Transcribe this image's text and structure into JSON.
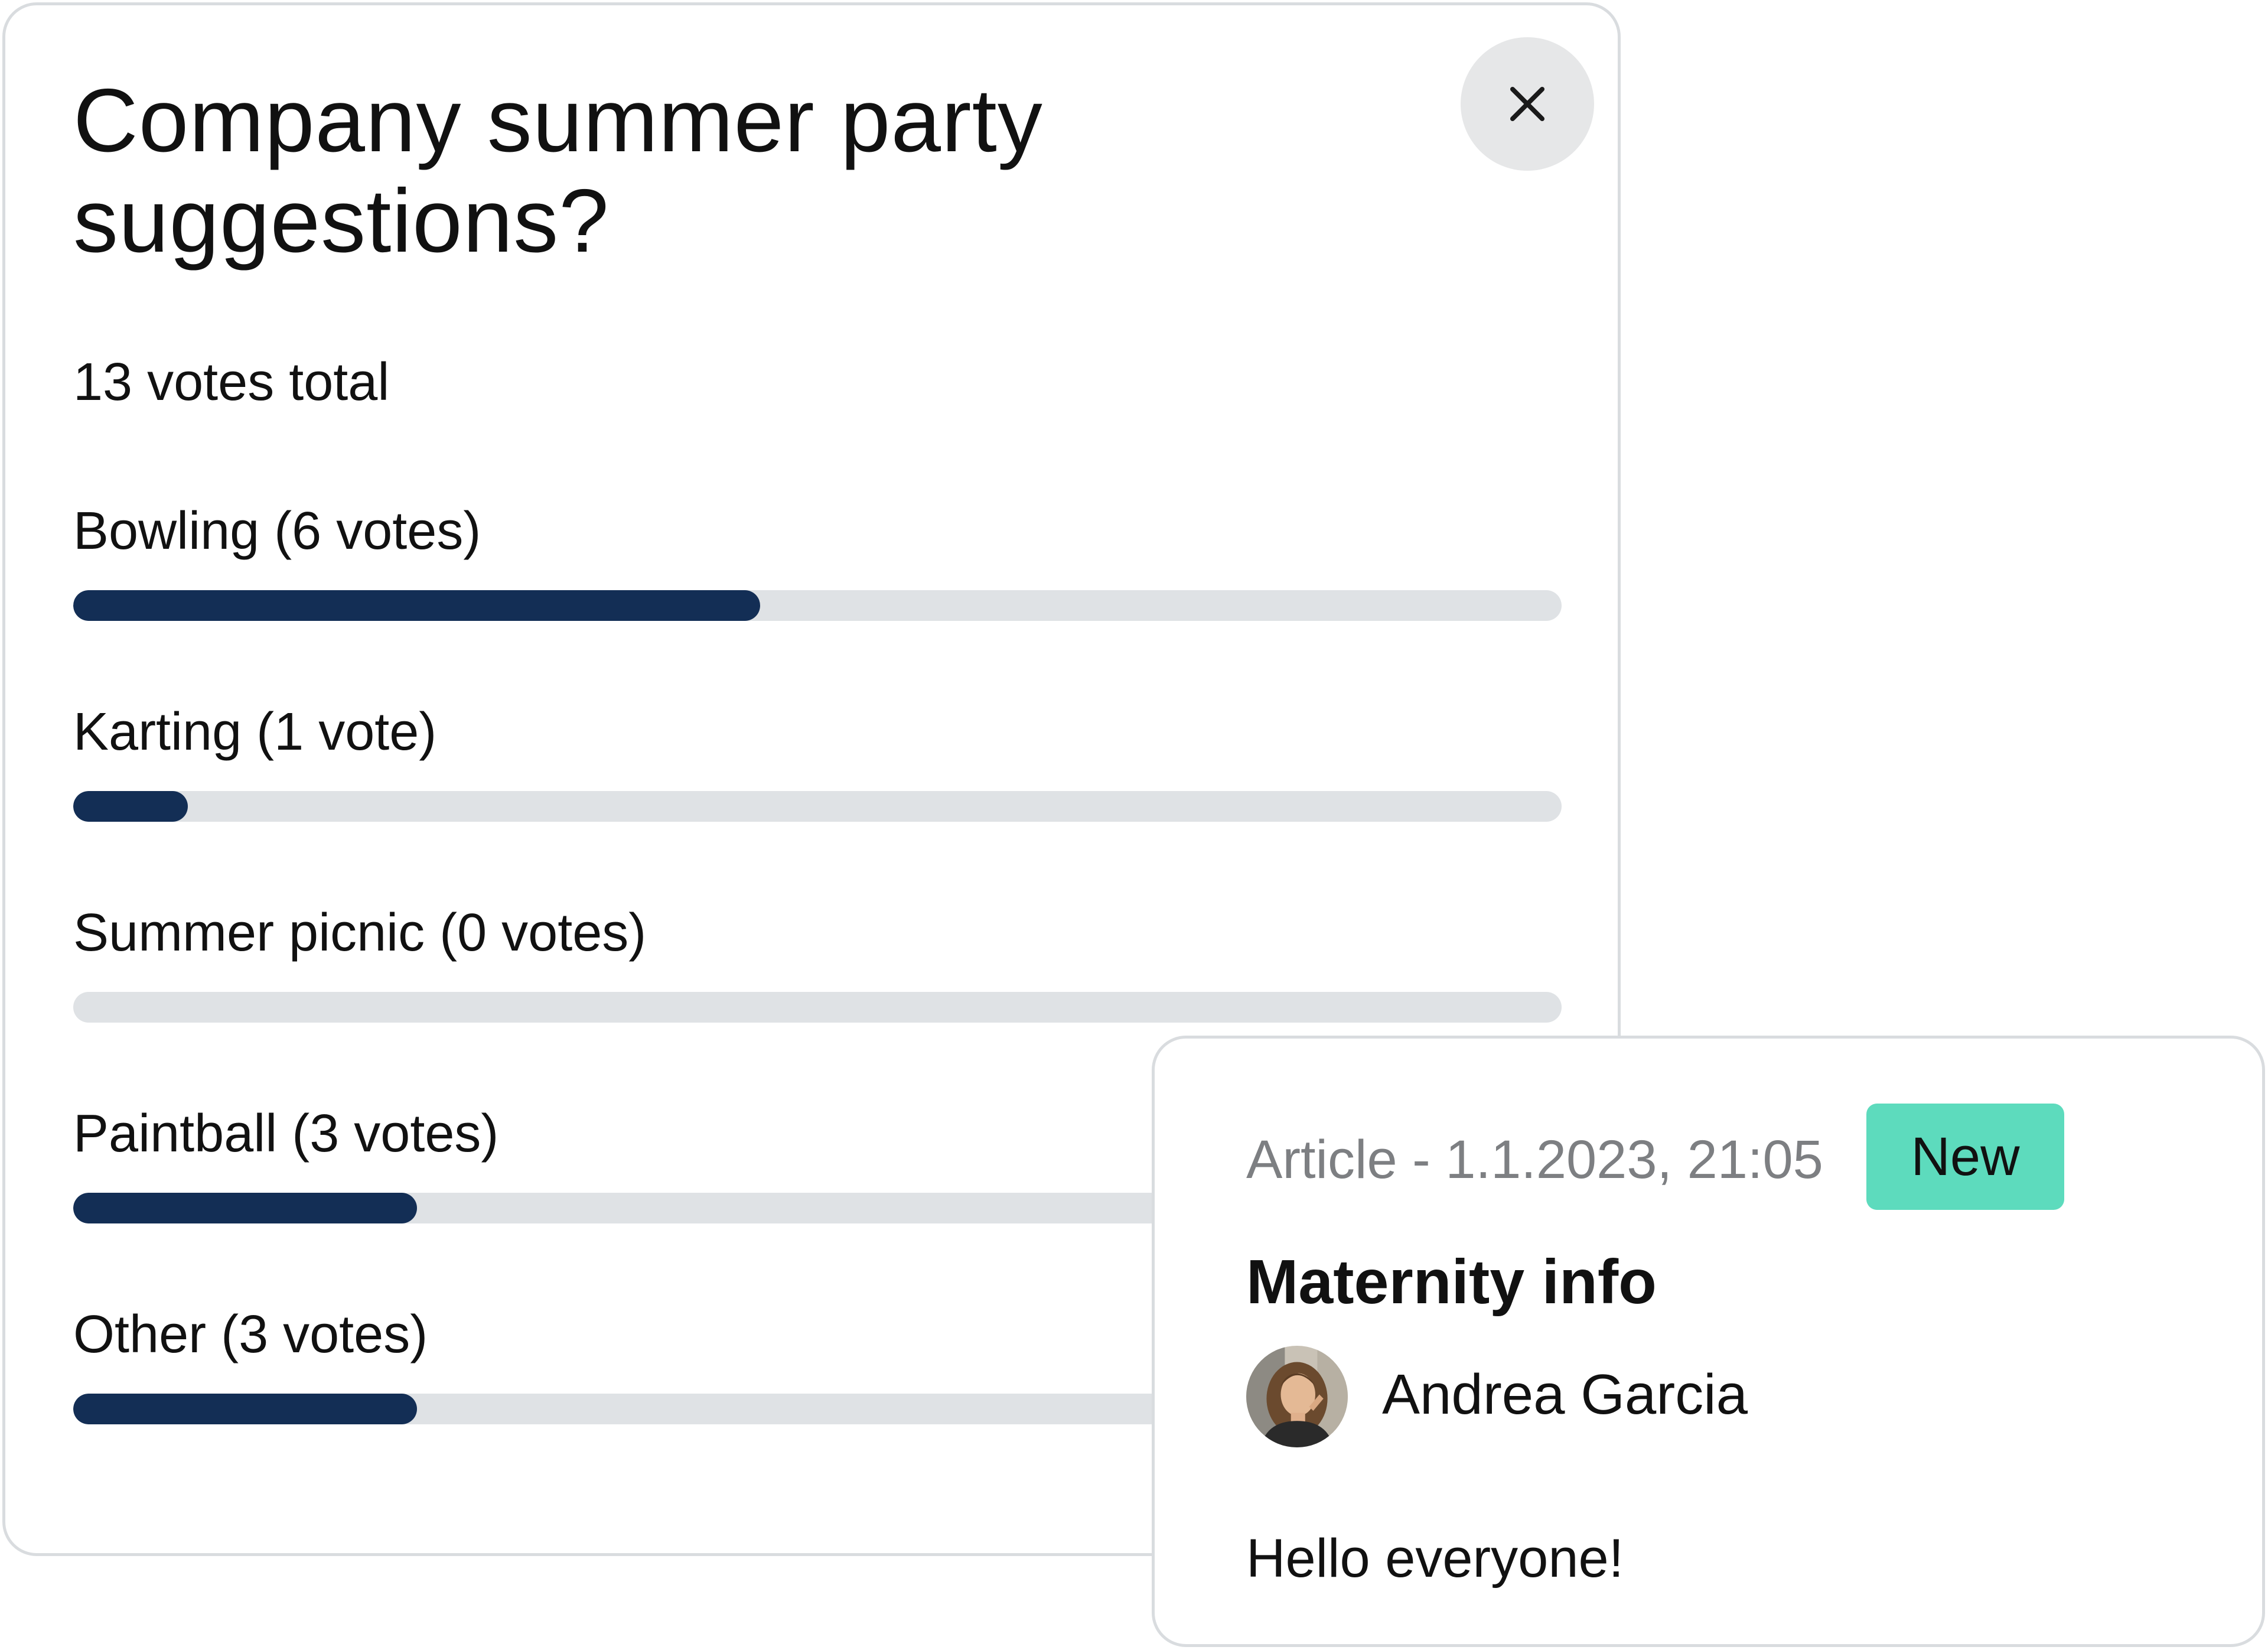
{
  "poll": {
    "title": "Company summer party suggestions?",
    "votes_total": "13 votes total",
    "max_votes": 13,
    "options": [
      {
        "label": "Bowling (6 votes)",
        "votes": 6
      },
      {
        "label": "Karting (1 vote)",
        "votes": 1
      },
      {
        "label": "Summer picnic (0 votes)",
        "votes": 0
      },
      {
        "label": "Paintball (3 votes)",
        "votes": 3
      },
      {
        "label": "Other (3 votes)",
        "votes": 3
      }
    ],
    "close_icon": "close-icon"
  },
  "article": {
    "meta": "Article - 1.1.2023, 21:05",
    "badge": "New",
    "title": "Maternity info",
    "author": "Andrea Garcia",
    "body": "Hello everyone!",
    "avatar_icon": "avatar-photo"
  },
  "colors": {
    "bar_fill": "#132e55",
    "bar_track": "#dfe2e5",
    "badge": "#5ddbbd",
    "close_bg": "#e6e7e8",
    "border": "#d9dcdf",
    "meta_text": "#7d7f82"
  }
}
